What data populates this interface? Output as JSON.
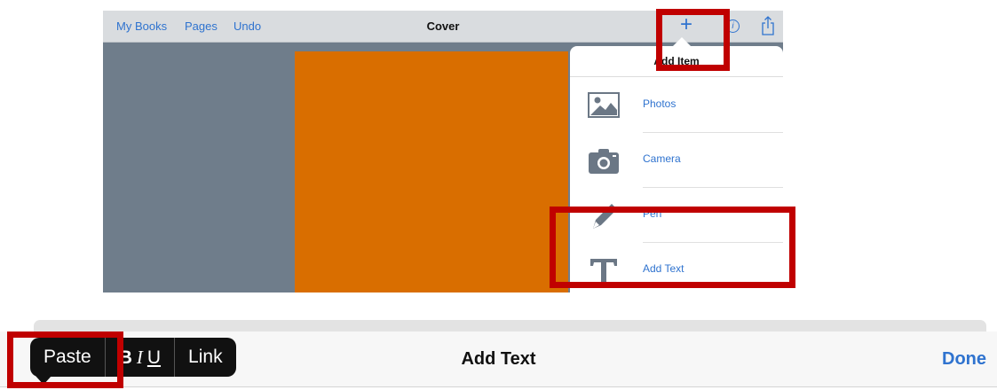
{
  "navbar": {
    "my_books": "My Books",
    "pages": "Pages",
    "undo": "Undo",
    "title": "Cover"
  },
  "popover": {
    "title": "Add Item",
    "items": [
      {
        "label": "Photos",
        "icon": "photo-icon"
      },
      {
        "label": "Camera",
        "icon": "camera-icon"
      },
      {
        "label": "Pen",
        "icon": "pen-icon"
      },
      {
        "label": "Add Text",
        "icon": "text-icon"
      }
    ]
  },
  "toolbar": {
    "title": "Add Text",
    "done": "Done"
  },
  "edit_menu": {
    "paste": "Paste",
    "bold": "B",
    "italic": "I",
    "underline": "U",
    "link": "Link"
  },
  "colors": {
    "accent": "#2f73cf",
    "cover": "#d96e00",
    "highlight": "#c00000"
  }
}
